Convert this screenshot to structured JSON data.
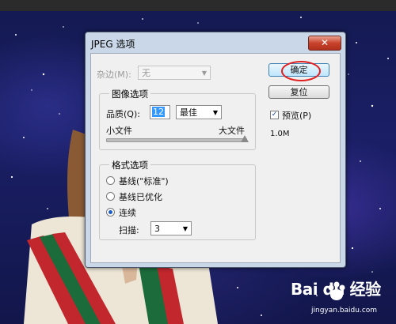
{
  "dialog": {
    "title": "JPEG 选项",
    "close_label": "✕",
    "matte": {
      "label": "杂边(M):",
      "value": "无"
    },
    "image_options": {
      "group_title": "图像选项",
      "quality_label": "品质(Q):",
      "quality_value": "12",
      "quality_preset": "最佳",
      "slider_min_label": "小文件",
      "slider_max_label": "大文件"
    },
    "format_options": {
      "group_title": "格式选项",
      "radio_baseline_standard": "基线(\"标准\")",
      "radio_baseline_optimized": "基线已优化",
      "radio_progressive": "连续",
      "selected": "连续",
      "scans_label": "扫描:",
      "scans_value": "3"
    },
    "buttons": {
      "ok": "确定",
      "reset": "复位"
    },
    "preview": {
      "label": "预览(P)",
      "checked": true
    },
    "file_size": "1.0M"
  },
  "watermark": {
    "brand": "Bai du 经验",
    "url": "jingyan.baidu.com"
  },
  "colors": {
    "highlight_circle": "#e02020",
    "selection": "#3399ff",
    "close_button": "#c9432c"
  }
}
